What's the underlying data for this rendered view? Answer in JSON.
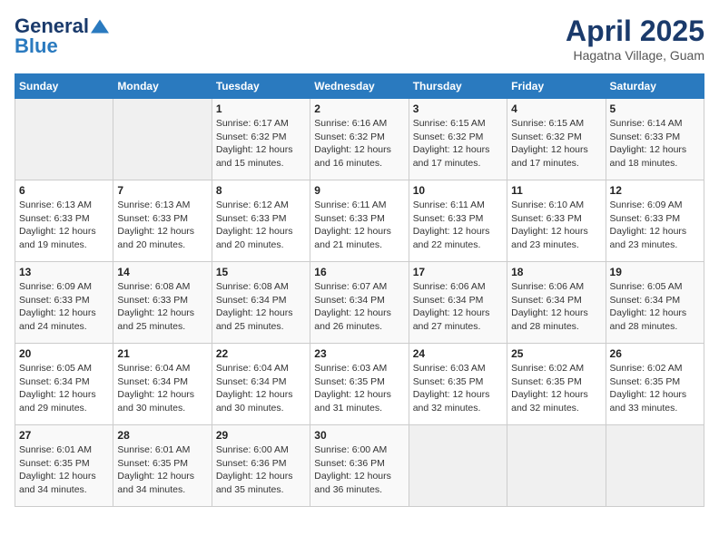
{
  "logo": {
    "general": "General",
    "blue": "Blue"
  },
  "title": "April 2025",
  "subtitle": "Hagatna Village, Guam",
  "weekdays": [
    "Sunday",
    "Monday",
    "Tuesday",
    "Wednesday",
    "Thursday",
    "Friday",
    "Saturday"
  ],
  "weeks": [
    [
      {
        "day": "",
        "sunrise": "",
        "sunset": "",
        "daylight": ""
      },
      {
        "day": "",
        "sunrise": "",
        "sunset": "",
        "daylight": ""
      },
      {
        "day": "1",
        "sunrise": "Sunrise: 6:17 AM",
        "sunset": "Sunset: 6:32 PM",
        "daylight": "Daylight: 12 hours and 15 minutes."
      },
      {
        "day": "2",
        "sunrise": "Sunrise: 6:16 AM",
        "sunset": "Sunset: 6:32 PM",
        "daylight": "Daylight: 12 hours and 16 minutes."
      },
      {
        "day": "3",
        "sunrise": "Sunrise: 6:15 AM",
        "sunset": "Sunset: 6:32 PM",
        "daylight": "Daylight: 12 hours and 17 minutes."
      },
      {
        "day": "4",
        "sunrise": "Sunrise: 6:15 AM",
        "sunset": "Sunset: 6:32 PM",
        "daylight": "Daylight: 12 hours and 17 minutes."
      },
      {
        "day": "5",
        "sunrise": "Sunrise: 6:14 AM",
        "sunset": "Sunset: 6:33 PM",
        "daylight": "Daylight: 12 hours and 18 minutes."
      }
    ],
    [
      {
        "day": "6",
        "sunrise": "Sunrise: 6:13 AM",
        "sunset": "Sunset: 6:33 PM",
        "daylight": "Daylight: 12 hours and 19 minutes."
      },
      {
        "day": "7",
        "sunrise": "Sunrise: 6:13 AM",
        "sunset": "Sunset: 6:33 PM",
        "daylight": "Daylight: 12 hours and 20 minutes."
      },
      {
        "day": "8",
        "sunrise": "Sunrise: 6:12 AM",
        "sunset": "Sunset: 6:33 PM",
        "daylight": "Daylight: 12 hours and 20 minutes."
      },
      {
        "day": "9",
        "sunrise": "Sunrise: 6:11 AM",
        "sunset": "Sunset: 6:33 PM",
        "daylight": "Daylight: 12 hours and 21 minutes."
      },
      {
        "day": "10",
        "sunrise": "Sunrise: 6:11 AM",
        "sunset": "Sunset: 6:33 PM",
        "daylight": "Daylight: 12 hours and 22 minutes."
      },
      {
        "day": "11",
        "sunrise": "Sunrise: 6:10 AM",
        "sunset": "Sunset: 6:33 PM",
        "daylight": "Daylight: 12 hours and 23 minutes."
      },
      {
        "day": "12",
        "sunrise": "Sunrise: 6:09 AM",
        "sunset": "Sunset: 6:33 PM",
        "daylight": "Daylight: 12 hours and 23 minutes."
      }
    ],
    [
      {
        "day": "13",
        "sunrise": "Sunrise: 6:09 AM",
        "sunset": "Sunset: 6:33 PM",
        "daylight": "Daylight: 12 hours and 24 minutes."
      },
      {
        "day": "14",
        "sunrise": "Sunrise: 6:08 AM",
        "sunset": "Sunset: 6:33 PM",
        "daylight": "Daylight: 12 hours and 25 minutes."
      },
      {
        "day": "15",
        "sunrise": "Sunrise: 6:08 AM",
        "sunset": "Sunset: 6:34 PM",
        "daylight": "Daylight: 12 hours and 25 minutes."
      },
      {
        "day": "16",
        "sunrise": "Sunrise: 6:07 AM",
        "sunset": "Sunset: 6:34 PM",
        "daylight": "Daylight: 12 hours and 26 minutes."
      },
      {
        "day": "17",
        "sunrise": "Sunrise: 6:06 AM",
        "sunset": "Sunset: 6:34 PM",
        "daylight": "Daylight: 12 hours and 27 minutes."
      },
      {
        "day": "18",
        "sunrise": "Sunrise: 6:06 AM",
        "sunset": "Sunset: 6:34 PM",
        "daylight": "Daylight: 12 hours and 28 minutes."
      },
      {
        "day": "19",
        "sunrise": "Sunrise: 6:05 AM",
        "sunset": "Sunset: 6:34 PM",
        "daylight": "Daylight: 12 hours and 28 minutes."
      }
    ],
    [
      {
        "day": "20",
        "sunrise": "Sunrise: 6:05 AM",
        "sunset": "Sunset: 6:34 PM",
        "daylight": "Daylight: 12 hours and 29 minutes."
      },
      {
        "day": "21",
        "sunrise": "Sunrise: 6:04 AM",
        "sunset": "Sunset: 6:34 PM",
        "daylight": "Daylight: 12 hours and 30 minutes."
      },
      {
        "day": "22",
        "sunrise": "Sunrise: 6:04 AM",
        "sunset": "Sunset: 6:34 PM",
        "daylight": "Daylight: 12 hours and 30 minutes."
      },
      {
        "day": "23",
        "sunrise": "Sunrise: 6:03 AM",
        "sunset": "Sunset: 6:35 PM",
        "daylight": "Daylight: 12 hours and 31 minutes."
      },
      {
        "day": "24",
        "sunrise": "Sunrise: 6:03 AM",
        "sunset": "Sunset: 6:35 PM",
        "daylight": "Daylight: 12 hours and 32 minutes."
      },
      {
        "day": "25",
        "sunrise": "Sunrise: 6:02 AM",
        "sunset": "Sunset: 6:35 PM",
        "daylight": "Daylight: 12 hours and 32 minutes."
      },
      {
        "day": "26",
        "sunrise": "Sunrise: 6:02 AM",
        "sunset": "Sunset: 6:35 PM",
        "daylight": "Daylight: 12 hours and 33 minutes."
      }
    ],
    [
      {
        "day": "27",
        "sunrise": "Sunrise: 6:01 AM",
        "sunset": "Sunset: 6:35 PM",
        "daylight": "Daylight: 12 hours and 34 minutes."
      },
      {
        "day": "28",
        "sunrise": "Sunrise: 6:01 AM",
        "sunset": "Sunset: 6:35 PM",
        "daylight": "Daylight: 12 hours and 34 minutes."
      },
      {
        "day": "29",
        "sunrise": "Sunrise: 6:00 AM",
        "sunset": "Sunset: 6:36 PM",
        "daylight": "Daylight: 12 hours and 35 minutes."
      },
      {
        "day": "30",
        "sunrise": "Sunrise: 6:00 AM",
        "sunset": "Sunset: 6:36 PM",
        "daylight": "Daylight: 12 hours and 36 minutes."
      },
      {
        "day": "",
        "sunrise": "",
        "sunset": "",
        "daylight": ""
      },
      {
        "day": "",
        "sunrise": "",
        "sunset": "",
        "daylight": ""
      },
      {
        "day": "",
        "sunrise": "",
        "sunset": "",
        "daylight": ""
      }
    ]
  ]
}
